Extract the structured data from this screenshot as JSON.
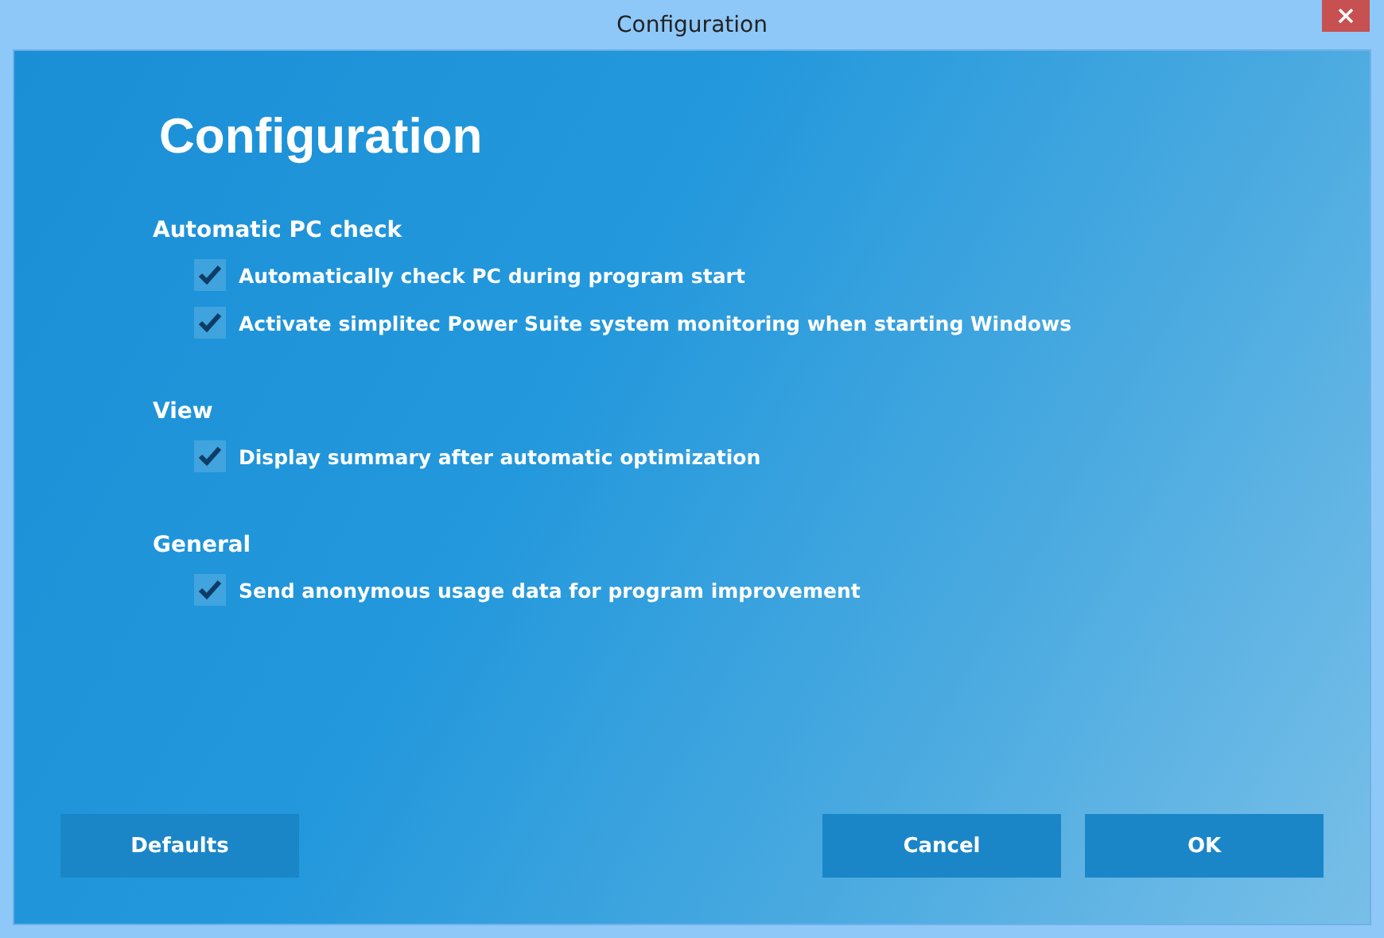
{
  "window": {
    "title": "Configuration"
  },
  "heading": "Configuration",
  "sections": [
    {
      "title": "Automatic PC check",
      "options": [
        {
          "label": "Automatically check PC during program start",
          "checked": true
        },
        {
          "label": "Activate simplitec Power Suite system monitoring when starting Windows",
          "checked": true
        }
      ]
    },
    {
      "title": "View",
      "options": [
        {
          "label": "Display summary after automatic optimization",
          "checked": true
        }
      ]
    },
    {
      "title": "General",
      "options": [
        {
          "label": "Send anonymous usage data for program improvement",
          "checked": true
        }
      ]
    }
  ],
  "buttons": {
    "left": [
      "Defaults"
    ],
    "right": [
      "Cancel",
      "OK"
    ]
  }
}
